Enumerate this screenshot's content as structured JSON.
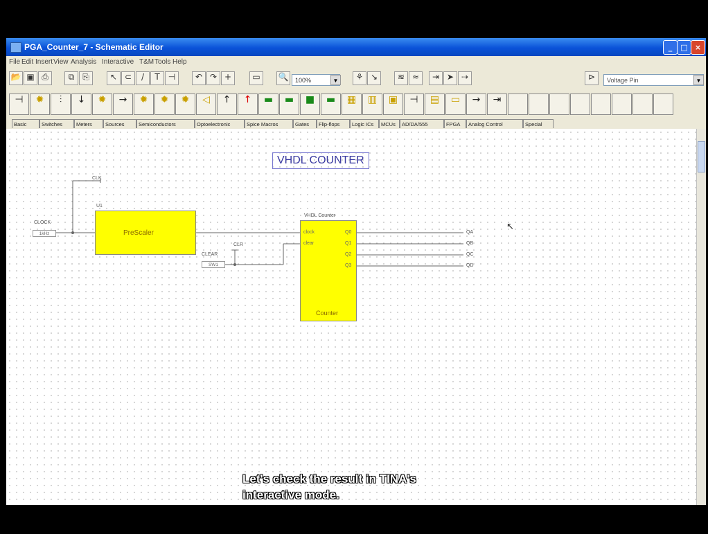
{
  "window": {
    "title": "PGA_Counter_7 - Schematic Editor"
  },
  "menu": [
    "File",
    "Edit",
    "Insert",
    "View",
    "Analysis",
    "Interactive",
    "T&M",
    "Tools",
    "Help"
  ],
  "toolbar": {
    "zoom": "100%",
    "component_type": "Voltage Pin"
  },
  "component_tabs": [
    "Basic",
    "Switches",
    "Meters",
    "Sources",
    "Semiconductors",
    "Optoelectronic",
    "Spice Macros",
    "Gates",
    "Flip-flops",
    "Logic ICs",
    "MCUs",
    "AD/DA/555",
    "FPGA",
    "Analog Control",
    "Special"
  ],
  "schematic": {
    "title": "VHDL COUNTER",
    "clk_top": "CLK",
    "clock_label": "CLOCK",
    "clock_value": "1kHz",
    "prescaler_ref": "U1",
    "prescaler_label": "PreScaler",
    "clear_label": "CLEAR",
    "clear_value": "SW1",
    "clr_label": "CLR",
    "counter_ref": "VHDL Counter",
    "counter_pins_in": [
      "clock",
      "clear"
    ],
    "counter_pins_out": [
      "Q0",
      "Q1",
      "Q2",
      "Q3"
    ],
    "counter_label": "Counter",
    "outputs": [
      "QA",
      "QB",
      "QC",
      "QD"
    ]
  },
  "caption": {
    "line1": "Let's check the result in TINA's",
    "line2": "interactive mode."
  }
}
